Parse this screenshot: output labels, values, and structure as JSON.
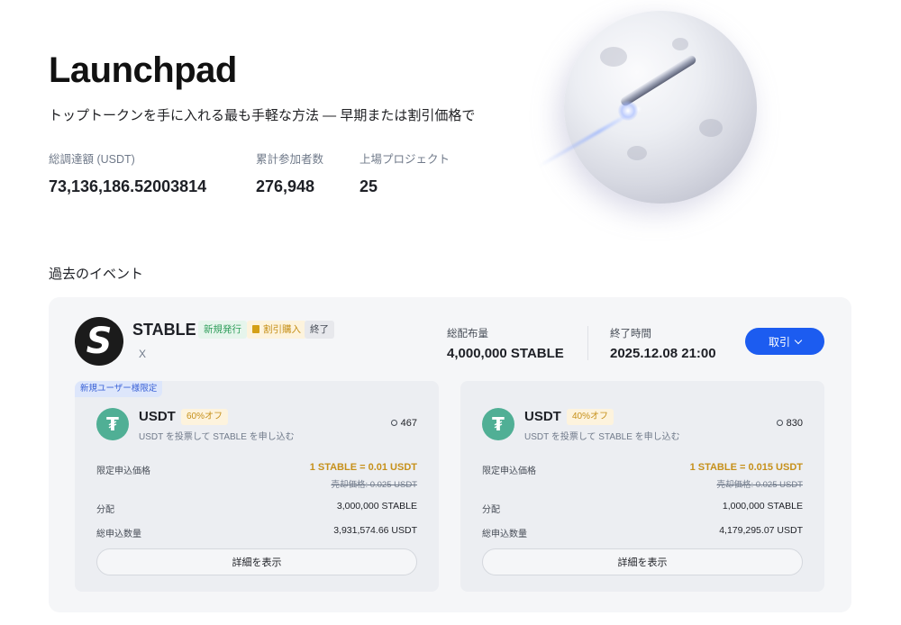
{
  "hero": {
    "title": "Launchpad",
    "subtitle": "トップトークンを手に入れる最も手軽な方法 — 早期または割引価格で",
    "stats": [
      {
        "label": "総調達額 (USDT)",
        "value": "73,136,186.52003814"
      },
      {
        "label": "累計参加者数",
        "value": "276,948"
      },
      {
        "label": "上場プロジェクト",
        "value": "25"
      }
    ]
  },
  "section": {
    "title": "過去のイベント"
  },
  "event": {
    "token_name": "STABLE",
    "badges": {
      "new": "新規発行",
      "discount": "割引購入",
      "ended": "終了"
    },
    "social": "X",
    "total_supply_label": "総配布量",
    "total_supply_value": "4,000,000 STABLE",
    "end_time_label": "終了時間",
    "end_time_value": "2025.12.08 21:00",
    "trade_button": "取引",
    "pools": [
      {
        "tag": "新規ユーザー様限定",
        "name": "USDT",
        "off": "60%オフ",
        "desc": "USDT を投票して STABLE を申し込む",
        "participants": "467",
        "price_label": "限定申込価格",
        "price": "1 STABLE = 0.01 USDT",
        "sale_price": "売却価格: 0.025 USDT",
        "alloc_label": "分配",
        "alloc": "3,000,000 STABLE",
        "total_label": "総申込数量",
        "total": "3,931,574.66 USDT",
        "detail_button": "詳細を表示"
      },
      {
        "name": "USDT",
        "off": "40%オフ",
        "desc": "USDT を投票して STABLE を申し込む",
        "participants": "830",
        "price_label": "限定申込価格",
        "price": "1 STABLE = 0.015 USDT",
        "sale_price": "売却価格: 0.025 USDT",
        "alloc_label": "分配",
        "alloc": "1,000,000 STABLE",
        "total_label": "総申込数量",
        "total": "4,179,295.07 USDT",
        "detail_button": "詳細を表示"
      }
    ]
  },
  "colors": {
    "accent": "#1c5cf0",
    "gold": "#c6901a",
    "usdt": "#50af95"
  }
}
